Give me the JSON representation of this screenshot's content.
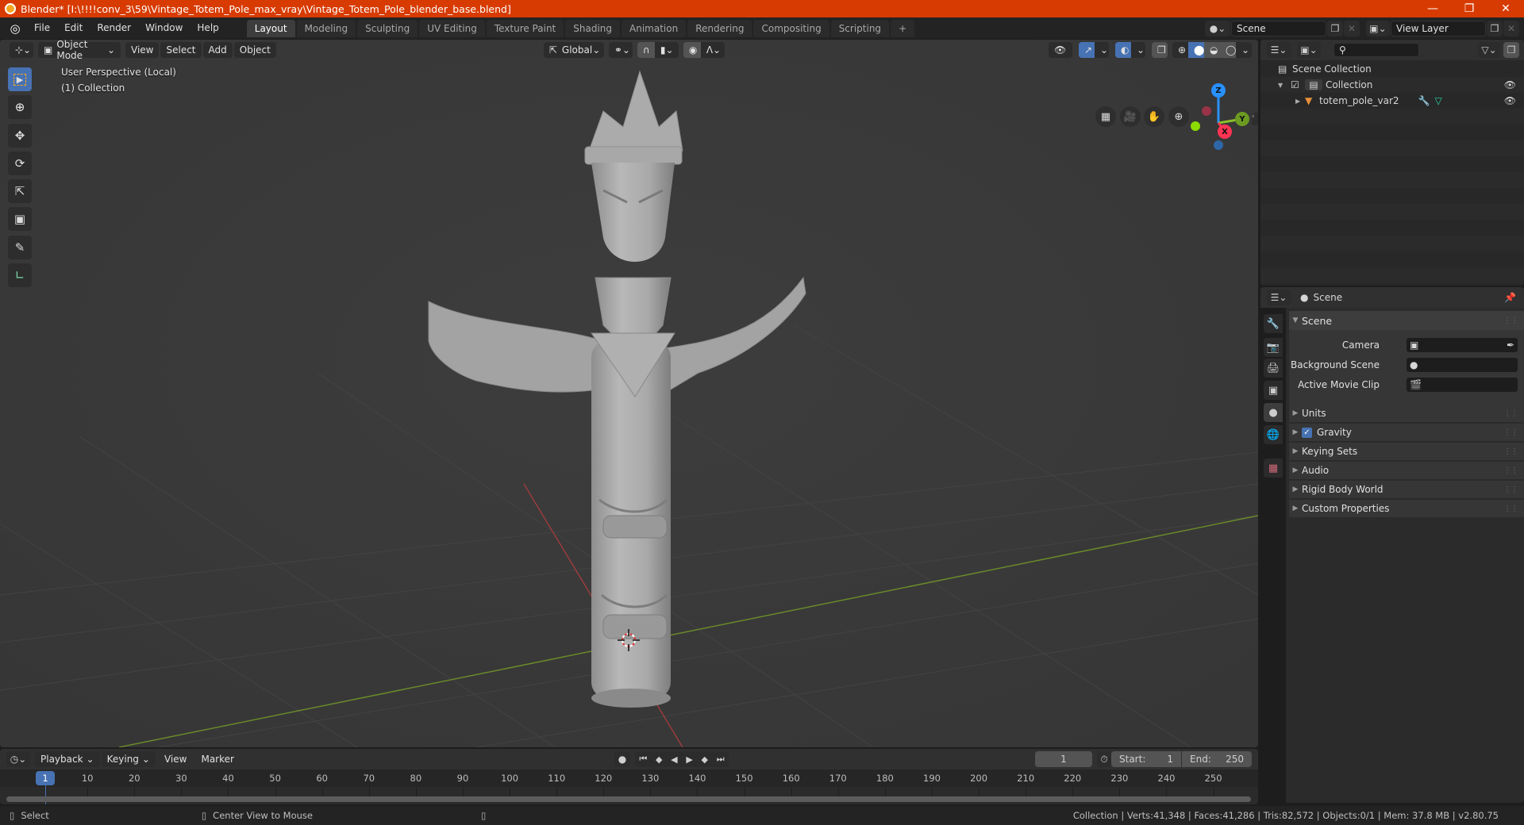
{
  "window": {
    "title": "Blender* [I:\\!!!!conv_3\\59\\Vintage_Totem_Pole_max_vray\\Vintage_Totem_Pole_blender_base.blend]",
    "controls": [
      "minimize",
      "restore",
      "close"
    ]
  },
  "menubar": {
    "menus": [
      "File",
      "Edit",
      "Render",
      "Window",
      "Help"
    ],
    "workspaces": [
      "Layout",
      "Modeling",
      "Sculpting",
      "UV Editing",
      "Texture Paint",
      "Shading",
      "Animation",
      "Rendering",
      "Compositing",
      "Scripting"
    ],
    "active_workspace": "Layout",
    "add_workspace": "+",
    "scene": "Scene",
    "view_layer": "View Layer"
  },
  "viewport": {
    "mode": "Object Mode",
    "menus": [
      "View",
      "Select",
      "Add",
      "Object"
    ],
    "transform_orientation": "Global",
    "overlay_text_line1": "User Perspective (Local)",
    "overlay_text_line2": "(1) Collection",
    "tools": [
      "select-box",
      "cursor",
      "move",
      "rotate",
      "scale",
      "transform",
      "annotate",
      "measure"
    ],
    "active_tool": "select-box",
    "nav_buttons": [
      "toggle-camera-grid",
      "camera-view",
      "pan",
      "zoom"
    ],
    "gizmo_axes": [
      "Z",
      "Y",
      "X"
    ],
    "axis_colors": {
      "x": "#ff3352",
      "y": "#8bdc00",
      "z": "#2890ff"
    },
    "model": "totem pole with wings"
  },
  "outliner": {
    "search_placeholder": "",
    "root": "Scene Collection",
    "items": [
      {
        "name": "Collection",
        "type": "collection",
        "checked": true,
        "visible": true
      },
      {
        "name": "totem_pole_var2",
        "type": "mesh-object",
        "visible": true
      }
    ]
  },
  "properties": {
    "context": "Scene",
    "tabs": [
      "tool",
      "render",
      "output",
      "view-layer",
      "scene",
      "world",
      "texture"
    ],
    "active_tab": "scene",
    "panel_title": "Scene",
    "fields": [
      {
        "label": "Camera",
        "value": ""
      },
      {
        "label": "Background Scene",
        "value": ""
      },
      {
        "label": "Active Movie Clip",
        "value": ""
      }
    ],
    "subpanels": [
      {
        "label": "Units"
      },
      {
        "label": "Gravity",
        "checkbox": true
      },
      {
        "label": "Keying Sets"
      },
      {
        "label": "Audio"
      },
      {
        "label": "Rigid Body World"
      },
      {
        "label": "Custom Properties"
      }
    ]
  },
  "timeline": {
    "menus": [
      "Playback",
      "Keying",
      "View",
      "Marker"
    ],
    "current_frame": "1",
    "start_label": "Start:",
    "start": "1",
    "end_label": "End:",
    "end": "250",
    "ruler": [
      "10",
      "20",
      "30",
      "40",
      "50",
      "60",
      "70",
      "80",
      "90",
      "100",
      "110",
      "120",
      "130",
      "140",
      "150",
      "160",
      "170",
      "180",
      "190",
      "200",
      "210",
      "220",
      "230",
      "240",
      "250"
    ],
    "playhead": "1"
  },
  "statusbar": {
    "left_action": "Select",
    "middle_action": "Center View to Mouse",
    "stats": "Collection | Verts:41,348 | Faces:41,286 | Tris:82,572 | Objects:0/1 | Mem: 37.8 MB | v2.80.75"
  }
}
